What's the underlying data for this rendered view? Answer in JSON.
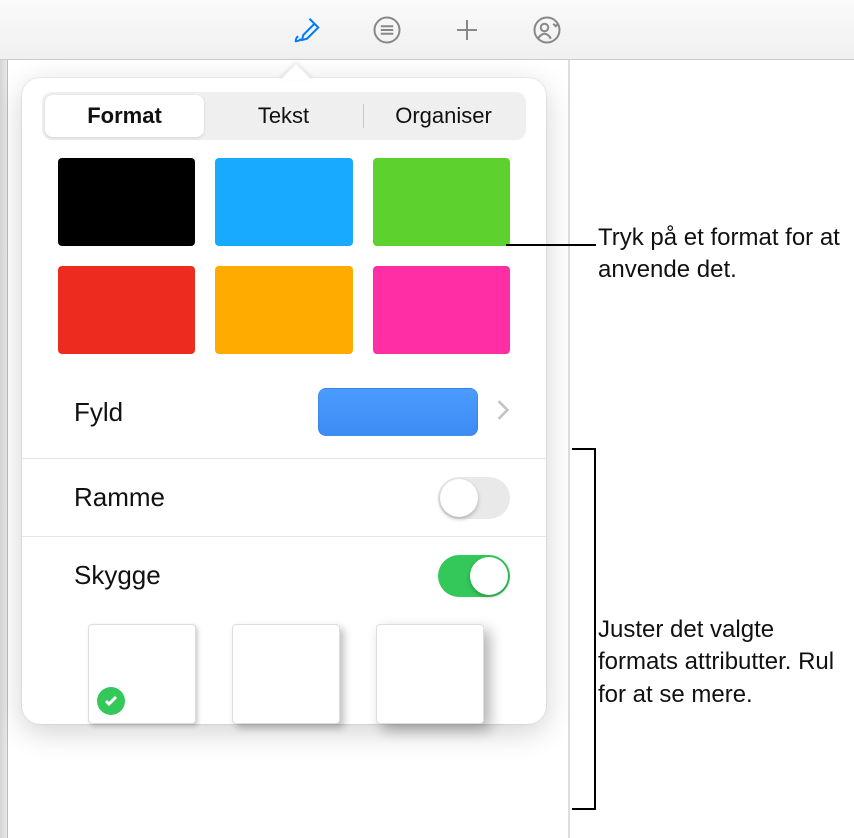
{
  "toolbar": {
    "icons": [
      "brush",
      "list",
      "add",
      "collaborate"
    ]
  },
  "popover": {
    "tabs": [
      {
        "label": "Format",
        "selected": true
      },
      {
        "label": "Tekst",
        "selected": false
      },
      {
        "label": "Organiser",
        "selected": false
      }
    ],
    "swatches": [
      "#000000",
      "#17aaff",
      "#5dd22f",
      "#ee2b1f",
      "#ffab00",
      "#ff2ea4"
    ],
    "fill": {
      "label": "Fyld",
      "color": "#3d8bf5"
    },
    "border": {
      "label": "Ramme",
      "enabled": false
    },
    "shadow": {
      "label": "Skygge",
      "enabled": true,
      "selected_option": 0
    }
  },
  "callouts": {
    "style_hint": "Tryk på et format for at anvende det.",
    "attributes_hint": "Juster det valgte formats attributter. Rul for at se mere."
  }
}
